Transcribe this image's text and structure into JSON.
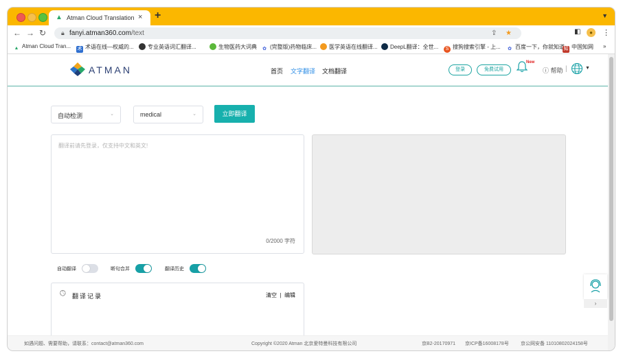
{
  "browser": {
    "tab_title": "Atman Cloud Translation",
    "tab_close": "×",
    "new_tab": "+",
    "url_host": "fanyi.atman360.com",
    "url_path": "/text",
    "bookmarks": [
      {
        "label": "Atman Cloud Tran...",
        "icon": "atman-icon",
        "color": "#2aa86a"
      },
      {
        "label": "术语在线—权威的...",
        "icon": "termonline-icon",
        "color": "#2f6fcf"
      },
      {
        "label": "专业英语词汇翻译...",
        "icon": "globe-bookmark-icon",
        "color": "#333333"
      },
      {
        "label": "生物医药大词典",
        "icon": "leaf-icon",
        "color": "#5bb83a"
      },
      {
        "label": "(完整版)药物临床...",
        "icon": "baidu-paw-icon",
        "color": "#3a5bd9"
      },
      {
        "label": "医学英语在线翻译...",
        "icon": "orange-circle-icon",
        "color": "#f39a1e"
      },
      {
        "label": "DeepL翻译：全世...",
        "icon": "deepl-icon",
        "color": "#0f2b46"
      },
      {
        "label": "搜狗搜索引擎 - 上...",
        "icon": "sogou-icon",
        "color": "#e8541f"
      },
      {
        "label": "百度一下，你就知道",
        "icon": "baidu-paw-icon",
        "color": "#3a5bd9"
      },
      {
        "label": "中国知网",
        "icon": "cnki-icon",
        "color": "#c0392b"
      }
    ],
    "bookmarks_overflow": "»"
  },
  "site": {
    "logo_text": "ATMAN",
    "nav": [
      "首页",
      "文字翻译",
      "文档翻译"
    ],
    "active_nav": "文字翻译",
    "login": "登录",
    "free_trial": "免费试用",
    "bell_badge": "New",
    "help": "帮助",
    "separator": "|"
  },
  "translator": {
    "source_lang": "自动检测",
    "domain": "medical",
    "translate_button": "立即翻译",
    "input_placeholder": "翻译前请先登录，仅支持中文和英文!",
    "counter": "0/2000 字符",
    "toggles": [
      {
        "label": "自动翻译",
        "on": false
      },
      {
        "label": "断句合并",
        "on": true
      },
      {
        "label": "翻译历史",
        "on": true
      }
    ]
  },
  "history": {
    "title": "翻译记录",
    "clear": "清空",
    "divider": "|",
    "edit": "编辑"
  },
  "footer": {
    "contact": "如遇问题、需要帮助，请联系：contact@atman360.com",
    "copyright": "Copyright ©2020 Atman   北京爱特曼科技有限公司",
    "license1": "京B2-20170971",
    "license2": "京ICP备16008178号",
    "license3": "京公网安备 11010802024158号"
  },
  "colors": {
    "accent": "#17b0ad",
    "active_nav": "#2f8ee6",
    "tab_strip": "#fbb700"
  }
}
